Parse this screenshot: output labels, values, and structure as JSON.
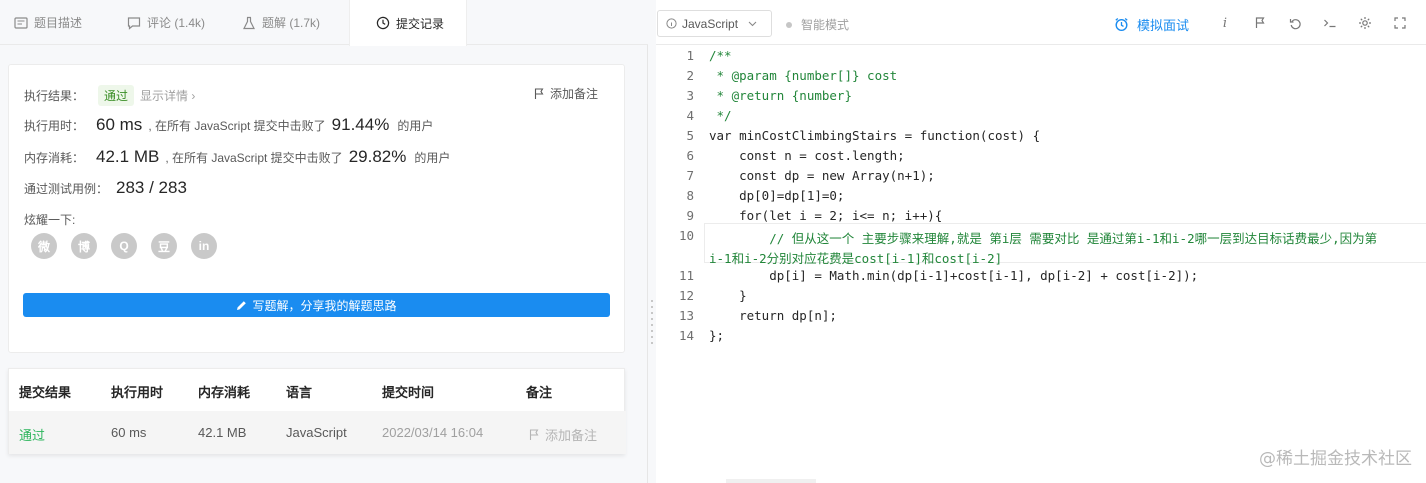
{
  "tabs": [
    {
      "label": "题目描述",
      "icon": "book-icon"
    },
    {
      "label": "评论 (1.4k)",
      "icon": "comment-icon"
    },
    {
      "label": "题解 (1.7k)",
      "icon": "flask-icon"
    },
    {
      "label": "提交记录",
      "icon": "clock-icon"
    }
  ],
  "result": {
    "label": "执行结果：",
    "status": "通过",
    "detail": "显示详情 ›",
    "add_note": "添加备注",
    "runtime_label": "执行用时：",
    "runtime_value": "60 ms",
    "runtime_text": ", 在所有 JavaScript 提交中击败了",
    "runtime_pct": "91.44%",
    "runtime_suffix": "的用户",
    "memory_label": "内存消耗：",
    "memory_value": "42.1 MB",
    "memory_text": ", 在所有 JavaScript 提交中击败了",
    "memory_pct": "29.82%",
    "memory_suffix": "的用户",
    "cases_label": "通过测试用例：",
    "cases_value": "283 / 283",
    "share_label": "炫耀一下:",
    "social": [
      "微",
      "博",
      "Q",
      "豆",
      "in"
    ],
    "write_button": "写题解，分享我的解题思路"
  },
  "submissions": {
    "headers": [
      "提交结果",
      "执行用时",
      "内存消耗",
      "语言",
      "提交时间",
      "备注"
    ],
    "rows": [
      {
        "status": "通过",
        "runtime": "60 ms",
        "memory": "42.1 MB",
        "lang": "JavaScript",
        "time": "2022/03/14 16:04",
        "note": "添加备注"
      }
    ]
  },
  "toolbar": {
    "language": "JavaScript",
    "smart_mode": "智能模式",
    "mock_interview": "模拟面试"
  },
  "code": [
    "/**",
    " * @param {number[]} cost",
    " * @return {number}",
    " */",
    "var minCostClimbingStairs = function(cost) {",
    "    const n = cost.length;",
    "    const dp = new Array(n+1);",
    "    dp[0]=dp[1]=0;",
    "    for(let i = 2; i<= n; i++){",
    "        // 但从这一个 主要步骤来理解,就是 第i层 需要对比 是通过第i-1和i-2哪一层到达目标话费最少,因为第",
    "i-1和i-2分别对应花费是cost[i-1]和cost[i-2]",
    "        dp[i] = Math.min(dp[i-1]+cost[i-1], dp[i-2] + cost[i-2]);",
    "    }",
    "    return dp[n];",
    "};"
  ],
  "line_numbers": [
    "1",
    "2",
    "3",
    "4",
    "5",
    "6",
    "7",
    "8",
    "9",
    "10",
    "11",
    "12",
    "13",
    "14"
  ],
  "watermark": "@稀土掘金技术社区",
  "colors": {
    "accent": "#1a8cf0",
    "success": "#3b8f27",
    "comment": "#22863a"
  }
}
